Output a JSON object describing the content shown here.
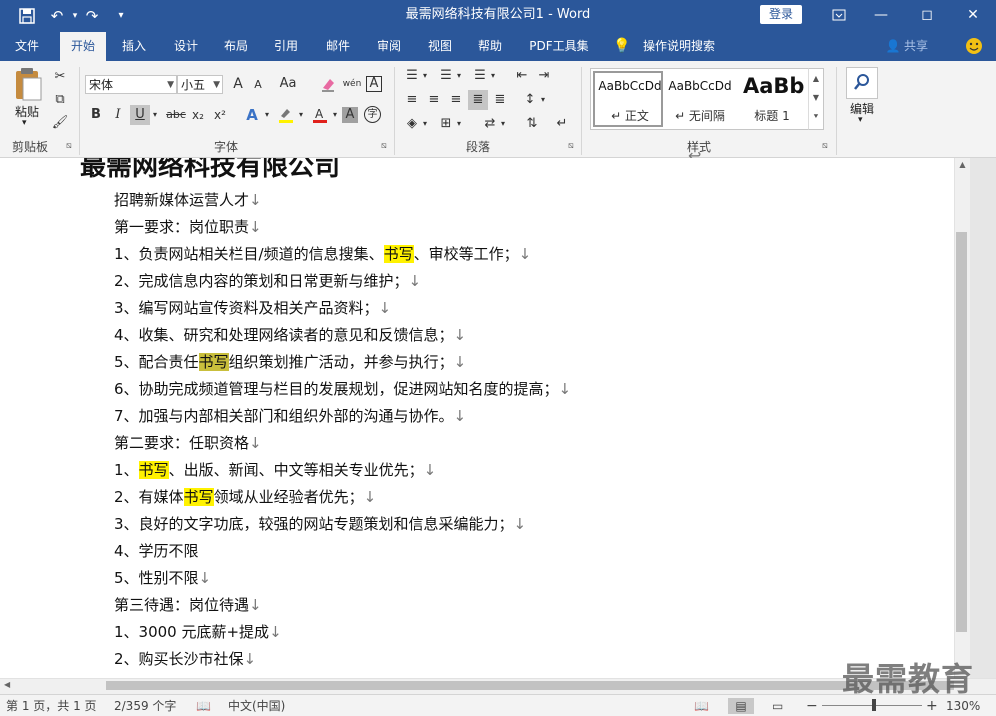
{
  "window": {
    "title": "最需网络科技有限公司1  -  Word",
    "login_label": "登录",
    "minimize_icon": "—",
    "restore_icon": "◻",
    "close_icon": "✕"
  },
  "quick_access": {
    "save_icon": "save-icon",
    "undo_icon": "undo-icon",
    "redo_icon": "redo-icon"
  },
  "tabs": [
    {
      "label": "文件"
    },
    {
      "label": "开始"
    },
    {
      "label": "插入"
    },
    {
      "label": "设计"
    },
    {
      "label": "布局"
    },
    {
      "label": "引用"
    },
    {
      "label": "邮件"
    },
    {
      "label": "审阅"
    },
    {
      "label": "视图"
    },
    {
      "label": "帮助"
    },
    {
      "label": "PDF工具集"
    },
    {
      "label": "操作说明搜索"
    }
  ],
  "share_label": "共享",
  "ribbon": {
    "clipboard": {
      "paste_label": "粘贴",
      "group_label": "剪贴板"
    },
    "font": {
      "font_name": "宋体",
      "font_size": "小五",
      "group_label": "字体",
      "bold": "B",
      "italic": "I",
      "underline": "U",
      "strike": "abc",
      "sub": "x₂",
      "sup": "x²",
      "grow": "A",
      "shrink": "A",
      "case": "Aa",
      "phonetic": "wén",
      "border": "A",
      "effect": "A",
      "shade": "A",
      "circle": "字"
    },
    "paragraph": {
      "group_label": "段落"
    },
    "styles": {
      "group_label": "样式",
      "items": [
        {
          "sample": "AaBbCcDd",
          "name": "↵ 正文"
        },
        {
          "sample": "AaBbCcDd",
          "name": "↵ 无间隔"
        },
        {
          "sample": "AaBb",
          "name": "标题 1"
        }
      ]
    },
    "editing": {
      "label": "编辑"
    }
  },
  "document": {
    "heading": "最需网络科技有限公司",
    "lines": [
      {
        "parts": [
          {
            "t": "招聘新媒体运营人才"
          },
          {
            "t": "↓",
            "m": 1
          }
        ]
      },
      {
        "parts": [
          {
            "t": "第一要求：岗位职责"
          },
          {
            "t": "↓",
            "m": 1
          }
        ]
      },
      {
        "parts": [
          {
            "t": "1、负责网站相关栏目/频道的信息搜集、"
          },
          {
            "t": "书写",
            "h": "y"
          },
          {
            "t": "、审校等工作；"
          },
          {
            "t": "↓",
            "m": 1
          }
        ]
      },
      {
        "parts": [
          {
            "t": "2、完成信息内容的策划和日常更新与维护；"
          },
          {
            "t": "↓",
            "m": 1
          }
        ]
      },
      {
        "parts": [
          {
            "t": "3、编写网站宣传资料及相关产品资料；"
          },
          {
            "t": "↓",
            "m": 1
          }
        ]
      },
      {
        "parts": [
          {
            "t": "4、收集、研究和处理网络读者的意见和反馈信息；"
          },
          {
            "t": "↓",
            "m": 1
          }
        ]
      },
      {
        "parts": [
          {
            "t": "5、配合责任"
          },
          {
            "t": "书写",
            "h": "o"
          },
          {
            "t": "组织策划推广活动，并参与执行；"
          },
          {
            "t": "↓",
            "m": 1
          }
        ]
      },
      {
        "parts": [
          {
            "t": "6、协助完成频道管理与栏目的发展规划，促进网站知名度的提高；"
          },
          {
            "t": "↓",
            "m": 1
          }
        ]
      },
      {
        "parts": [
          {
            "t": "7、加强与内部相关部门和组织外部的沟通与协作。"
          },
          {
            "t": "↓",
            "m": 1
          }
        ]
      },
      {
        "parts": [
          {
            "t": "第二要求：任职资格"
          },
          {
            "t": "↓",
            "m": 1
          }
        ]
      },
      {
        "parts": [
          {
            "t": "1、"
          },
          {
            "t": "书写",
            "h": "y"
          },
          {
            "t": "、出版、新闻、中文等相关专业优先；"
          },
          {
            "t": "↓",
            "m": 1
          }
        ]
      },
      {
        "parts": [
          {
            "t": "2、有媒体"
          },
          {
            "t": "书写",
            "h": "y"
          },
          {
            "t": "领域从业经验者优先；"
          },
          {
            "t": "↓",
            "m": 1
          }
        ]
      },
      {
        "parts": [
          {
            "t": "3、良好的文字功底，较强的网站专题策划和信息采编能力；"
          },
          {
            "t": "↓",
            "m": 1
          }
        ]
      },
      {
        "parts": [
          {
            "t": "4、学历不限"
          }
        ]
      },
      {
        "parts": [
          {
            "t": "5、性别不限"
          },
          {
            "t": "↓",
            "m": 1
          }
        ]
      },
      {
        "parts": [
          {
            "t": "第三待遇：岗位待遇"
          },
          {
            "t": "↓",
            "m": 1
          }
        ]
      },
      {
        "parts": [
          {
            "t": "1、3000 元底薪+提成"
          },
          {
            "t": "↓",
            "m": 1
          }
        ]
      },
      {
        "parts": [
          {
            "t": "2、购买长沙市社保"
          },
          {
            "t": "↓",
            "m": 1
          }
        ]
      }
    ]
  },
  "status": {
    "page": "第 1 页，共 1 页",
    "words": "2/359 个字",
    "language": "中文(中国)",
    "zoom": "130%",
    "zoom_minus": "−",
    "zoom_plus": "+"
  },
  "watermark": "最需教育"
}
